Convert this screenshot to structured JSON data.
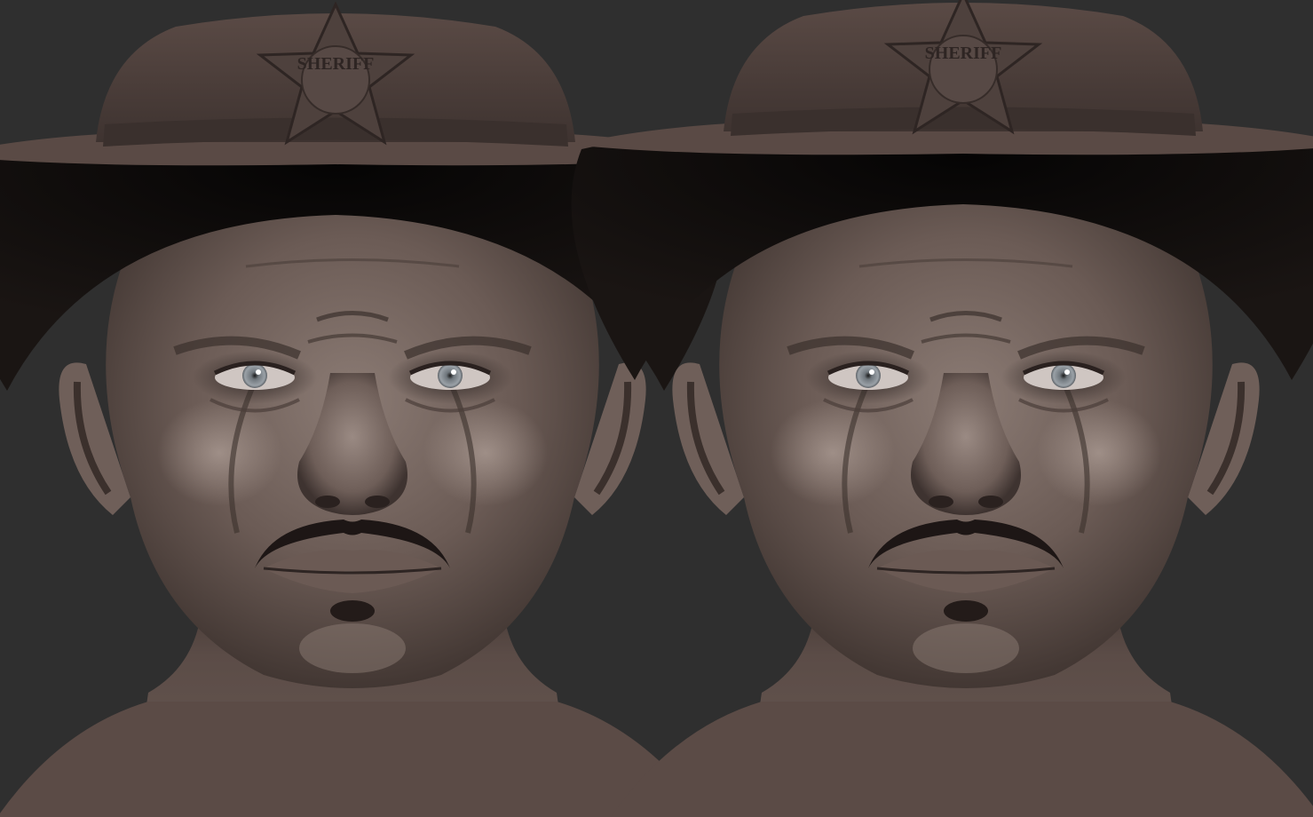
{
  "image": {
    "description_type": "sculpt-render",
    "views": [
      {
        "id": "left",
        "badge_text": "SHERIFF"
      },
      {
        "id": "right",
        "badge_text": "SHERIFF"
      }
    ]
  },
  "colors": {
    "background": "#2f2f2f",
    "skin_base": "#6f5f59",
    "skin_shadow": "#3b302c",
    "skin_highlight": "#9a8a83",
    "hat_base": "#4a3d39",
    "hat_shadow": "#120f0e",
    "eye_iris": "#8e959b",
    "mustache": "#1d1615"
  }
}
